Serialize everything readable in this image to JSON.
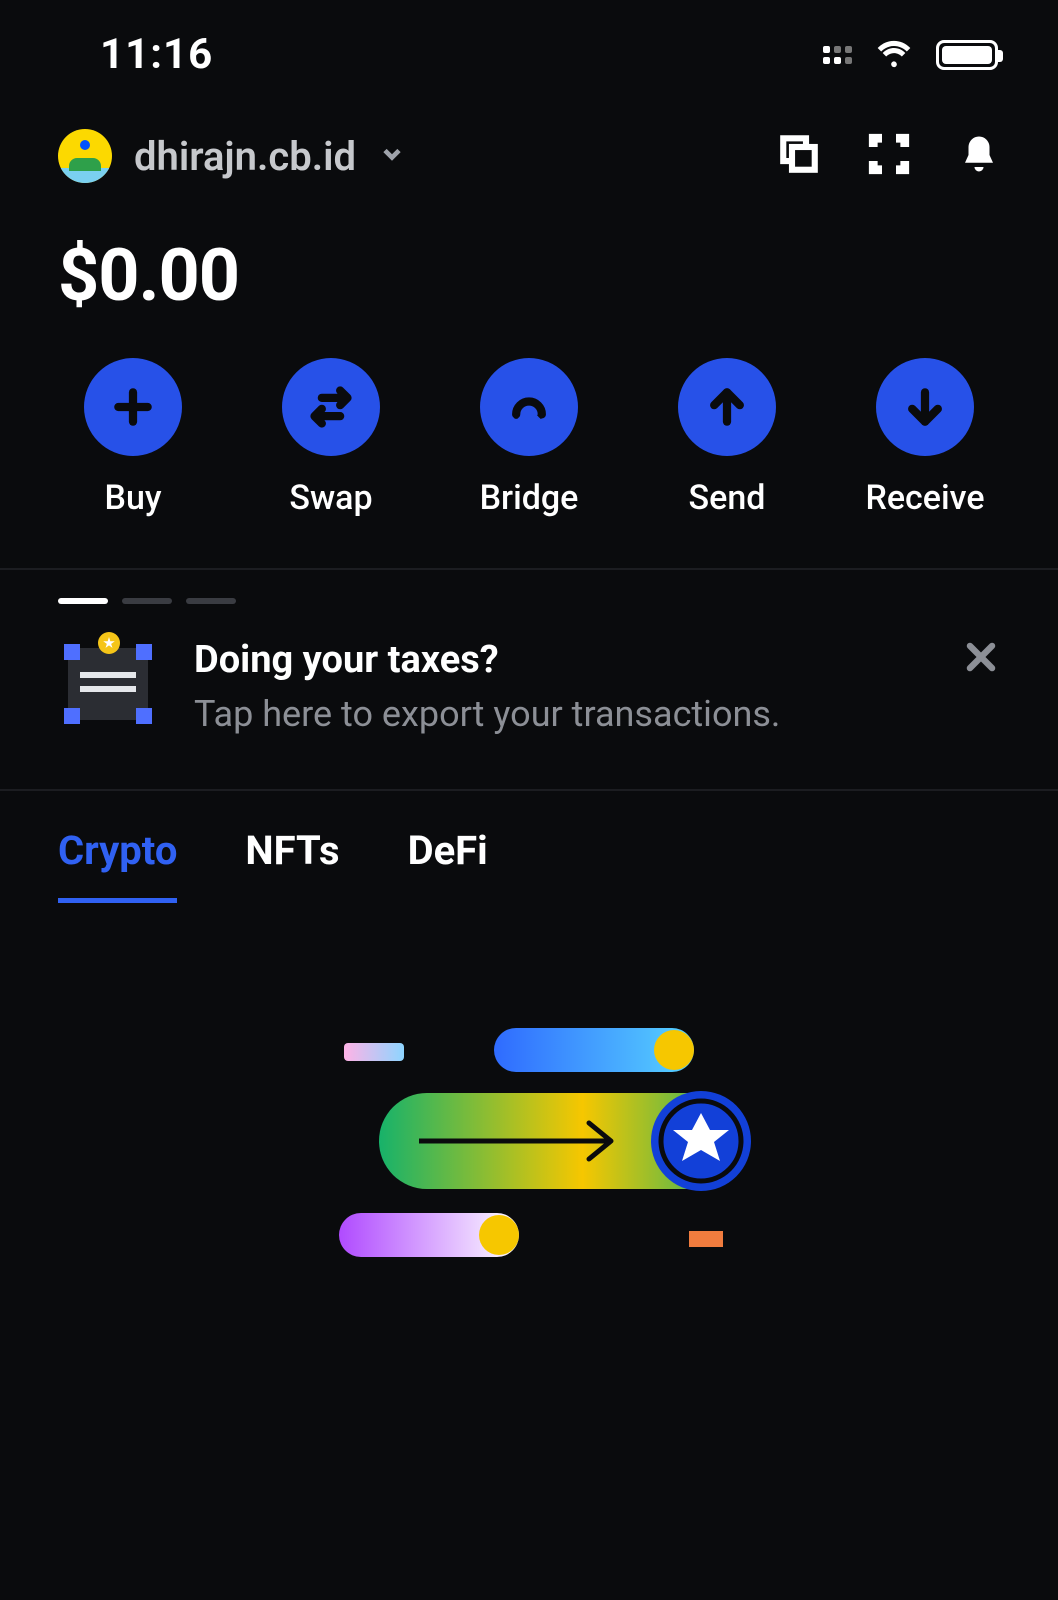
{
  "status": {
    "time": "11:16"
  },
  "header": {
    "account_name": "dhirajn.cb.id"
  },
  "balance": "$0.00",
  "actions": {
    "buy": "Buy",
    "swap": "Swap",
    "bridge": "Bridge",
    "send": "Send",
    "receive": "Receive"
  },
  "banner": {
    "title": "Doing your taxes?",
    "subtitle": "Tap here to export your transactions."
  },
  "tabs": {
    "crypto": "Crypto",
    "nfts": "NFTs",
    "defi": "DeFi"
  },
  "colors": {
    "accent": "#2751e8",
    "accent_text": "#3061f2",
    "bg": "#0a0b0d"
  }
}
